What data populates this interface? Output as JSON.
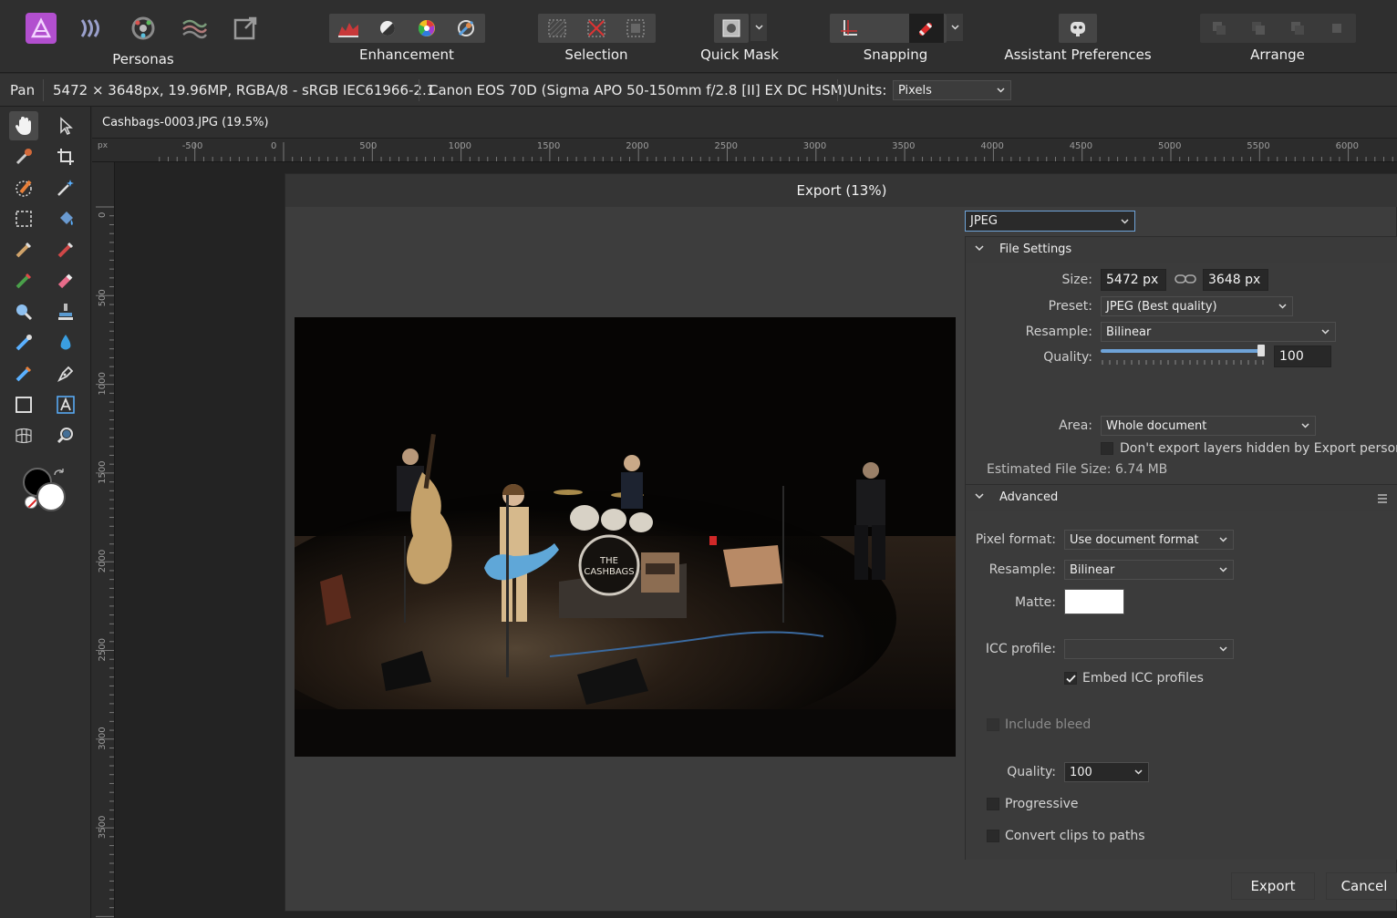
{
  "toolbar": {
    "personas_label": "Personas",
    "enhancement_label": "Enhancement",
    "selection_label": "Selection",
    "quickmask_label": "Quick Mask",
    "snapping_label": "Snapping",
    "assistant_label": "Assistant Preferences",
    "arrange_label": "Arrange"
  },
  "context": {
    "tool_name": "Pan",
    "doc_info": "5472 × 3648px, 19.96MP, RGBA/8 - sRGB IEC61966-2.1",
    "camera_info": "Canon EOS 70D (Sigma APO 50-150mm f/2.8 [II] EX DC HSM)",
    "units_label": "Units:",
    "units_value": "Pixels"
  },
  "document": {
    "tab_title": "Cashbags-0003.JPG (19.5%)",
    "ruler_unit": "px",
    "hruler_labels": [
      "-500",
      "0",
      "500",
      "1000",
      "1500",
      "2000",
      "2500",
      "3000",
      "3500",
      "4000",
      "4500",
      "5000",
      "5500",
      "6000"
    ],
    "vruler_labels": [
      "0",
      "500",
      "1000",
      "1500",
      "2000",
      "2500",
      "3000",
      "3500"
    ]
  },
  "dialog": {
    "title": "Export (13%)",
    "format": "JPEG",
    "file_settings": {
      "header": "File Settings",
      "size_label": "Size:",
      "width": "5472 px",
      "height": "3648 px",
      "preset_label": "Preset:",
      "preset_value": "JPEG (Best quality)",
      "resample_label": "Resample:",
      "resample_value": "Bilinear",
      "quality_label": "Quality:",
      "quality_value": "100",
      "quality_fraction": 1.0,
      "area_label": "Area:",
      "area_value": "Whole document",
      "hidden_layers_label": "Don't export layers hidden by Export persona",
      "estimated_size": "Estimated File Size: 6.74 MB"
    },
    "advanced": {
      "header": "Advanced",
      "pixel_format_label": "Pixel format:",
      "pixel_format_value": "Use document format",
      "resample_label": "Resample:",
      "resample_value": "Bilinear",
      "matte_label": "Matte:",
      "matte_color": "#ffffff",
      "icc_label": "ICC profile:",
      "icc_value": "",
      "embed_icc_label": "Embed ICC profiles",
      "embed_icc_checked": true,
      "include_bleed_label": "Include bleed",
      "quality_label": "Quality:",
      "quality_value": "100",
      "progressive_label": "Progressive",
      "convert_clips_label": "Convert clips to paths"
    },
    "export_label": "Export",
    "cancel_label": "Cancel"
  },
  "colors": {
    "accent": "#6ea3d8",
    "persona_icon": "#b04ec9"
  }
}
